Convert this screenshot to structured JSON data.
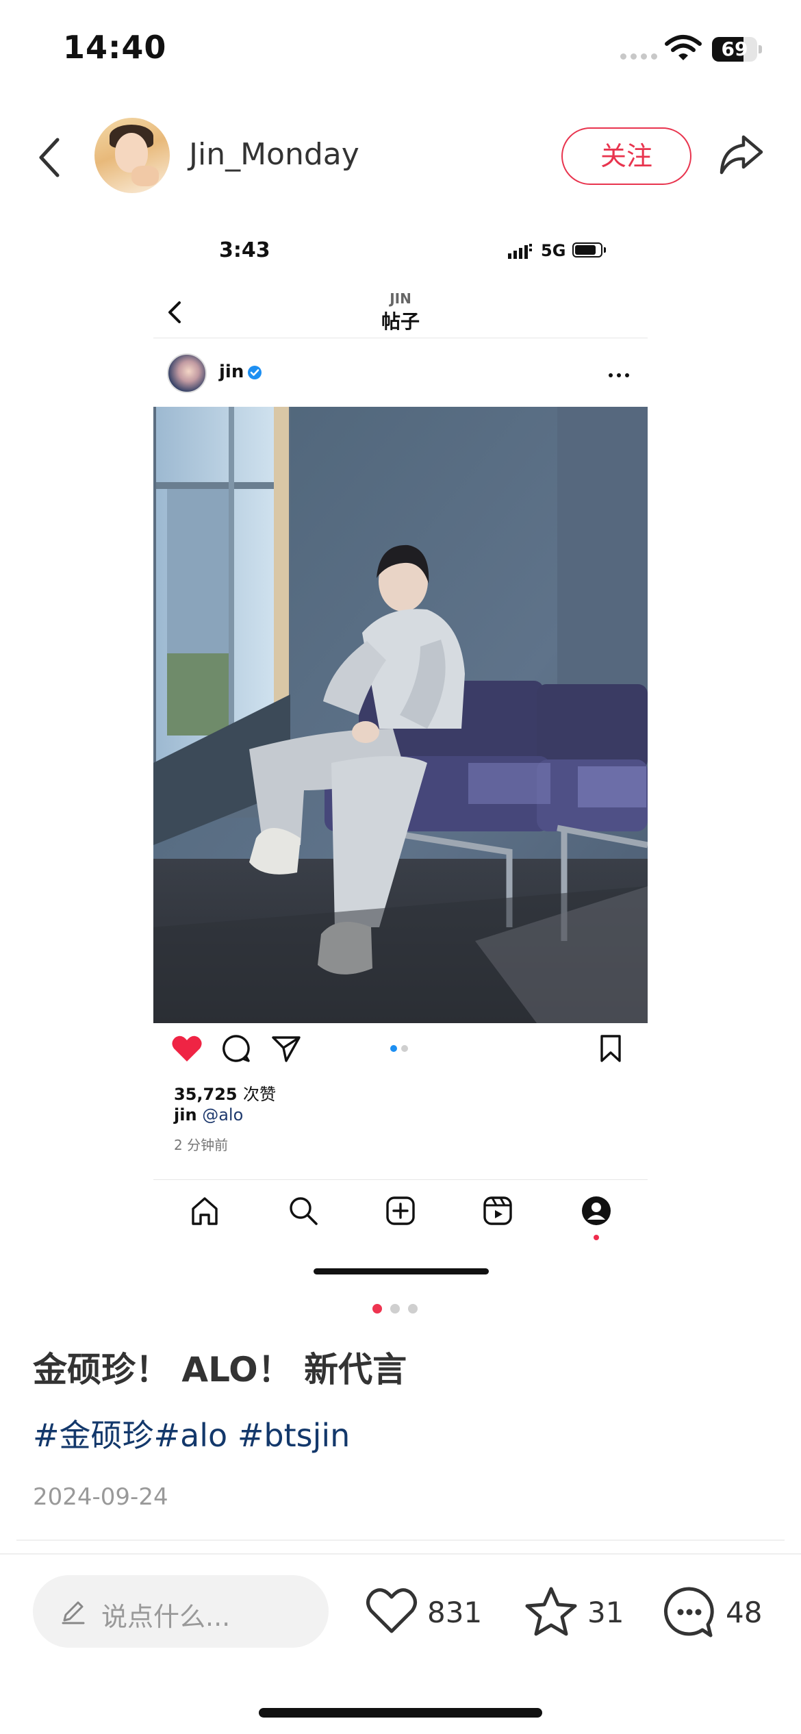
{
  "status_bar": {
    "time": "14:40",
    "battery_level": "69",
    "battery_fraction": 0.69
  },
  "header": {
    "username": "Jin_Monday",
    "follow_label": "关注"
  },
  "embedded": {
    "status_time": "3:43",
    "network": "5G",
    "nav_subtitle": "JIN",
    "nav_title": "帖子",
    "post_username": "jin",
    "likes_count": "35,725",
    "likes_unit": "次赞",
    "caption_user": "jin",
    "caption_mention": "@alo",
    "time_ago": "2 分钟前",
    "carousel_active_index": 0,
    "carousel_total": 2,
    "colors": {
      "heart": "#ef2444",
      "verified": "#1d8ff2",
      "mention": "#1f3a6e"
    }
  },
  "carousel": {
    "total": 3,
    "active_index": 0
  },
  "note": {
    "title": "金硕珍！ ALO！ 新代言",
    "hashtags": "#金硕珍#alo #btsjin",
    "date": "2024-09-24"
  },
  "bottom_bar": {
    "comment_placeholder": "说点什么...",
    "likes": "831",
    "favorites": "31",
    "comments": "48"
  },
  "colors": {
    "accent": "#e8344e",
    "hashtag": "#13386b"
  },
  "icons": [
    "back-icon",
    "share-icon",
    "wifi-icon",
    "heart-icon",
    "comment-icon",
    "send-icon",
    "bookmark-icon",
    "home-icon",
    "search-icon",
    "create-icon",
    "reels-icon",
    "profile-icon",
    "pencil-icon",
    "star-icon",
    "more-icon",
    "verified-icon"
  ]
}
